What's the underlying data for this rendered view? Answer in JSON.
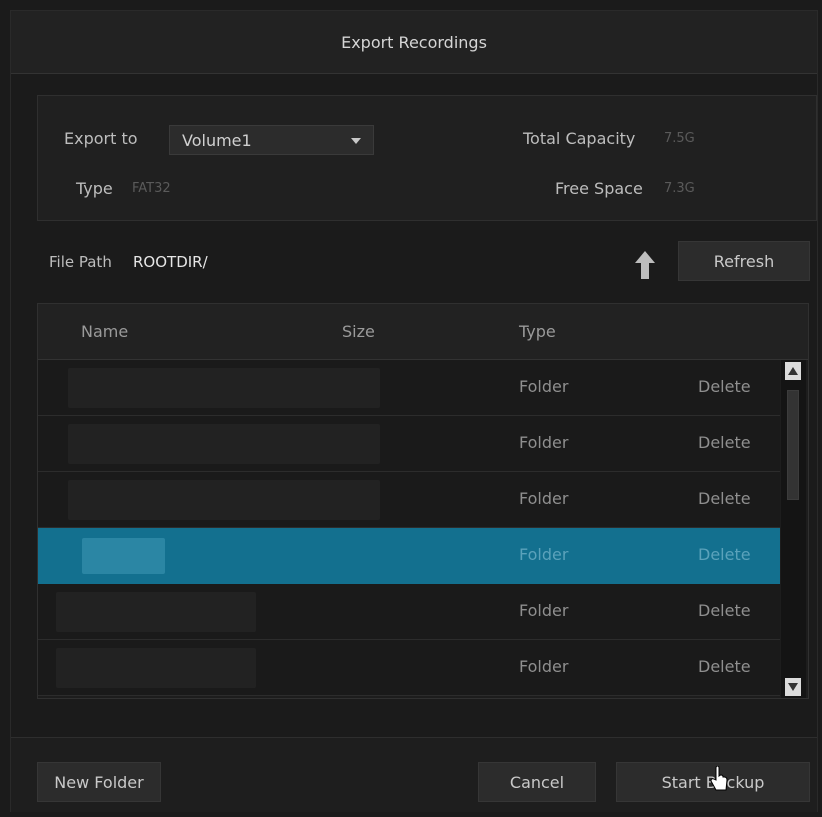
{
  "dialog": {
    "title": "Export Recordings"
  },
  "info": {
    "export_to_label": "Export to",
    "export_to_value": "Volume1",
    "type_label": "Type",
    "type_value": "FAT32",
    "total_capacity_label": "Total Capacity",
    "total_capacity_value": "7.5G",
    "free_space_label": "Free Space",
    "free_space_value": "7.3G"
  },
  "path": {
    "label": "File Path",
    "value": "ROOTDIR/",
    "up_icon": "up-arrow-icon",
    "refresh_label": "Refresh"
  },
  "table": {
    "columns": [
      "Name",
      "Size",
      "Type"
    ],
    "rows": [
      {
        "type": "Folder",
        "action": "Delete",
        "selected": false
      },
      {
        "type": "Folder",
        "action": "Delete",
        "selected": false
      },
      {
        "type": "Folder",
        "action": "Delete",
        "selected": false
      },
      {
        "type": "Folder",
        "action": "Delete",
        "selected": true
      },
      {
        "type": "Folder",
        "action": "Delete",
        "selected": false
      },
      {
        "type": "Folder",
        "action": "Delete",
        "selected": false
      }
    ]
  },
  "footer": {
    "new_folder_label": "New Folder",
    "cancel_label": "Cancel",
    "start_backup_label": "Start Backup"
  },
  "colors": {
    "selected_row": "#13708f",
    "background": "#1b1b1b"
  }
}
